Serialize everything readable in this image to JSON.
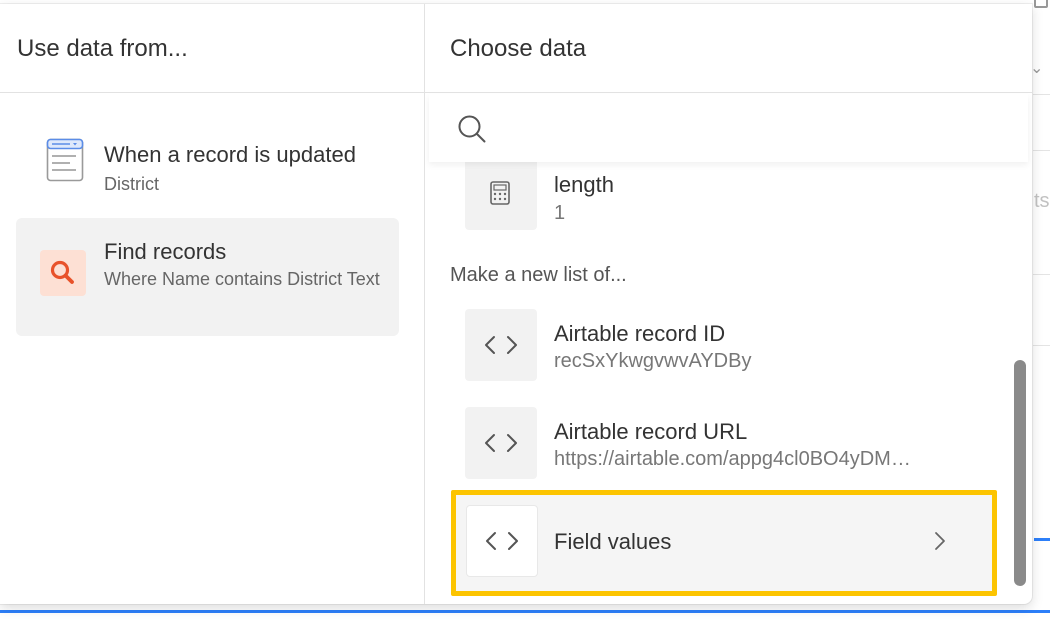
{
  "left_panel": {
    "header": "Use data from...",
    "sources": [
      {
        "title": "When a record is updated",
        "subtitle": "District",
        "icon": "table-record-icon"
      },
      {
        "title": "Find records",
        "subtitle": "Where Name contains District Text",
        "icon": "search-icon",
        "selected": true
      }
    ]
  },
  "right_panel": {
    "header": "Choose data",
    "search": {
      "placeholder": ""
    },
    "items": [
      {
        "title": "length",
        "subtitle": "1",
        "icon": "calculator-icon"
      }
    ],
    "section_label": "Make a new list of...",
    "list_items": [
      {
        "title": "Airtable record ID",
        "subtitle": "recSxYkwgvwvAYDBy",
        "icon": "code-icon"
      },
      {
        "title": "Airtable record URL",
        "subtitle": "https://airtable.com/appg4cl0BO4yDM…",
        "icon": "code-icon"
      },
      {
        "title": "Field values",
        "subtitle": "",
        "icon": "code-icon",
        "has_submenu": true,
        "highlighted": true
      }
    ]
  },
  "background": {
    "partial_text": "ts"
  },
  "colors": {
    "highlight": "#fcc400",
    "accent_blue": "#2d7ff9",
    "search_icon_bg": "#fde0d4",
    "search_icon_fg": "#e8522a"
  }
}
